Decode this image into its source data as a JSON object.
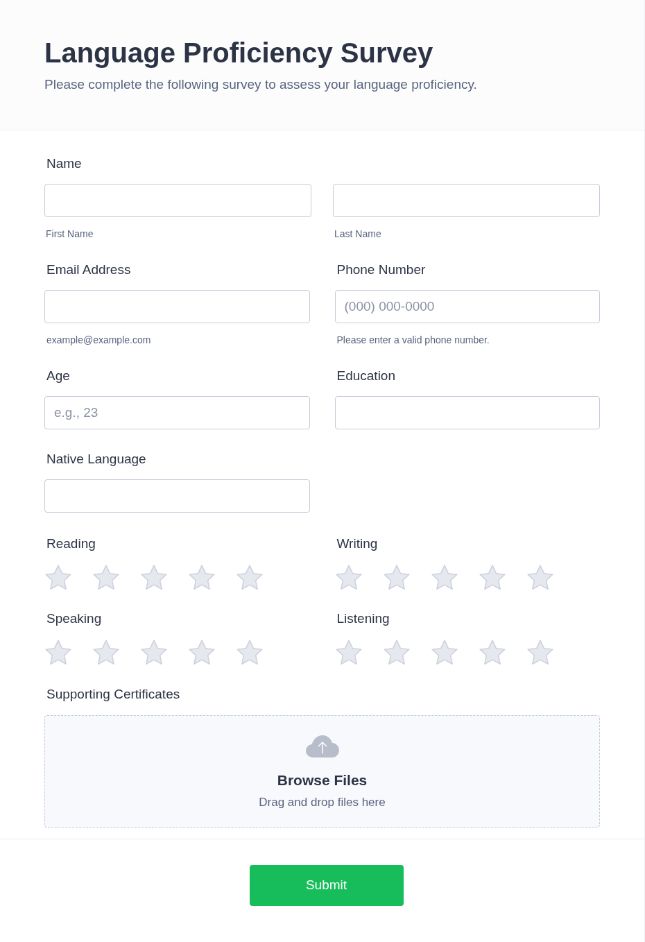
{
  "header": {
    "title": "Language Proficiency Survey",
    "subtitle": "Please complete the following survey to assess your language proficiency."
  },
  "name_field": {
    "label": "Name",
    "inputs": [
      {
        "sublabel": "First Name"
      },
      {
        "sublabel": "Last Name"
      }
    ]
  },
  "fields": [
    {
      "label": "Email Address",
      "hint": "example@example.com"
    },
    {
      "label": "Phone Number",
      "placeholder": "(000) 000-0000",
      "hint": "Please enter a valid phone number."
    },
    {
      "label": "Age",
      "placeholder": "e.g., 23"
    },
    {
      "label": "Education"
    },
    {
      "label": "Native Language"
    }
  ],
  "ratings": [
    {
      "label": "Reading",
      "stars": 0
    },
    {
      "label": "Writing",
      "stars": 0
    },
    {
      "label": "Speaking",
      "stars": 0
    },
    {
      "label": "Listening",
      "stars": 0
    }
  ],
  "upload": {
    "label": "Supporting Certificates",
    "title": "Browse Files",
    "hint": "Drag and drop files here"
  },
  "submit": {
    "label": "Submit"
  }
}
